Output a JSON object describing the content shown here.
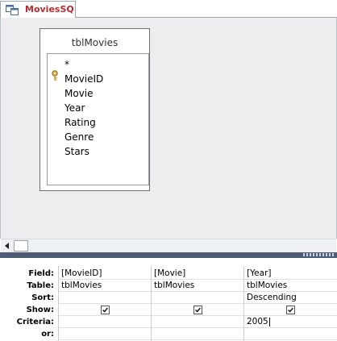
{
  "tab": {
    "title": "MoviesSQ"
  },
  "table_box": {
    "title": "tblMovies",
    "fields": [
      "*",
      "MovieID",
      "Movie",
      "Year",
      "Rating",
      "Genre",
      "Stars"
    ],
    "primary_key": "MovieID"
  },
  "grid": {
    "row_labels": [
      "Field:",
      "Table:",
      "Sort:",
      "Show:",
      "Criteria:",
      "or:"
    ],
    "columns": [
      {
        "field": "[MovieID]",
        "table": "tblMovies",
        "sort": "",
        "show": true,
        "criteria": "",
        "or": ""
      },
      {
        "field": "[Movie]",
        "table": "tblMovies",
        "sort": "",
        "show": true,
        "criteria": "",
        "or": ""
      },
      {
        "field": "[Year]",
        "table": "tblMovies",
        "sort": "Descending",
        "show": true,
        "criteria": "2005",
        "or": ""
      }
    ]
  },
  "colors": {
    "tab_title": "#c0282d",
    "splitter": "#4c5c74",
    "pane_bg": "#ededf0"
  }
}
